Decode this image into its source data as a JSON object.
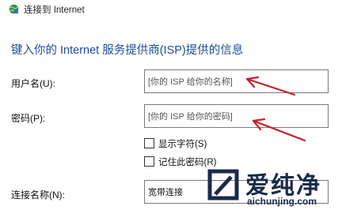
{
  "window": {
    "title": "连接到 Internet",
    "icon": "network-globe-icon"
  },
  "heading": "键入你的 Internet 服务提供商(ISP)提供的信息",
  "form": {
    "username_label": "用户名(U):",
    "username_placeholder": "[你的 ISP 给你的名称]",
    "password_label": "密码(P):",
    "password_placeholder": "[你的 ISP 给你的密码]",
    "show_chars_label": "显示字符(S)",
    "remember_password_label": "记住此密码(R)",
    "connection_name_label": "连接名称(N):",
    "connection_name_value": "宽带连接"
  },
  "annotation": {
    "arrow_color": "#c8202a"
  },
  "watermark": {
    "text": "爱纯净",
    "url": "aichunjing.com",
    "color": "#1b2a4a"
  }
}
